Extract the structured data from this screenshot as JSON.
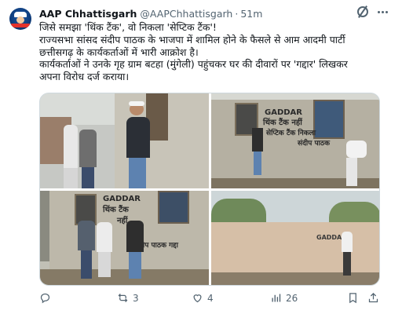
{
  "post": {
    "author_name": "AAP Chhattisgarh",
    "handle": "@AAPChhattisgarh",
    "separator": "·",
    "time": "51m",
    "lines": [
      "जिसे समझा 'थिंक टैंक', वो निकला 'सेप्टिक टैंक'!",
      "राज्यसभा सांसद संदीप पाठक के भाजपा में शामिल होने के फैसले से आम आदमी पार्टी",
      "छत्तीसगढ़ के कार्यकर्ताओं में भारी आक्रोश है।",
      "कार्यकर्ताओं ने उनके गृह ग्राम बटहा (मुंगेली) पहुंचकर घर की दीवारों पर 'गद्दार' लिखकर",
      "अपना विरोध दर्ज कराया।"
    ]
  },
  "media": {
    "photo2_wall_text": [
      "GADDAR",
      "थिंक टैंक नहीं",
      "सेप्टिक टैंक निकला",
      "संदीप पाठक"
    ],
    "photo3_wall_text": [
      "GADDAR",
      "थिंक टैंक",
      "नहीं",
      "संदीप पाठक गद्दा"
    ],
    "photo4_wall_text": "GADDAR"
  },
  "actions": {
    "replies": "",
    "reposts": "3",
    "likes": "4",
    "views": "26"
  },
  "icons": {
    "avatar": "aap-logo-avatar",
    "header": [
      "grok-icon",
      "more-icon"
    ],
    "actions": [
      "reply-icon",
      "repost-icon",
      "like-icon",
      "views-icon",
      "bookmark-icon",
      "share-icon"
    ]
  },
  "colors": {
    "text": "#0f1419",
    "secondary": "#536471",
    "border": "#cfd9de"
  }
}
